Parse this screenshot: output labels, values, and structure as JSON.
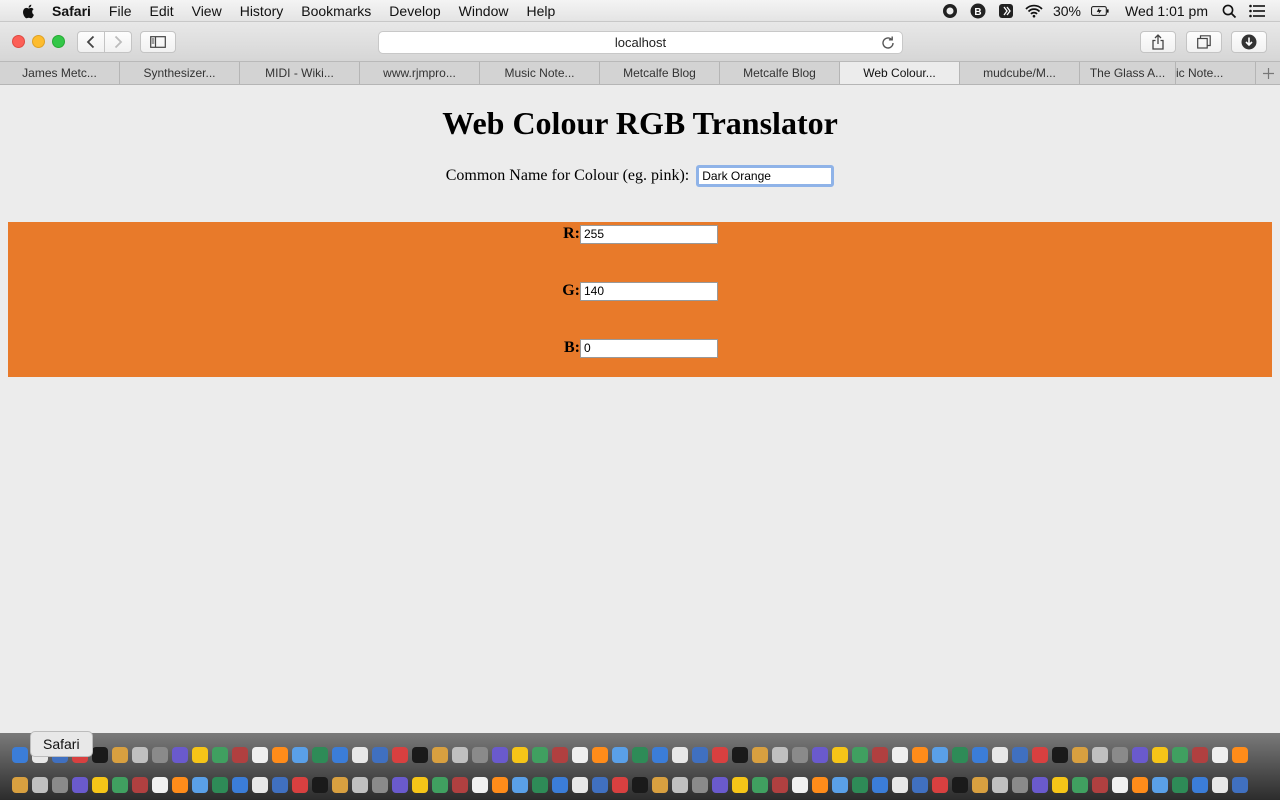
{
  "menubar": {
    "app_name": "Safari",
    "items": [
      "File",
      "Edit",
      "View",
      "History",
      "Bookmarks",
      "Develop",
      "Window",
      "Help"
    ],
    "battery": "30%",
    "clock": "Wed 1:01 pm"
  },
  "toolbar": {
    "address": "localhost"
  },
  "tabs": [
    "James Metc...",
    "Synthesizer...",
    "MIDI - Wiki...",
    "www.rjmpro...",
    "Music Note...",
    "Metcalfe Blog",
    "Metcalfe Blog",
    "Web Colour...",
    "mudcube/M...",
    "The Glass A...",
    "ic Note..."
  ],
  "page": {
    "title": "Web Colour RGB Translator",
    "name_label": "Common Name for Colour (eg. pink):",
    "name_value": "Dark Orange",
    "swatch_color": "#e87a2a",
    "r_label": "R:",
    "r_value": "255",
    "g_label": "G:",
    "g_value": "140",
    "b_label": "B:",
    "b_value": "0"
  },
  "dock": {
    "tooltip": "Safari"
  }
}
